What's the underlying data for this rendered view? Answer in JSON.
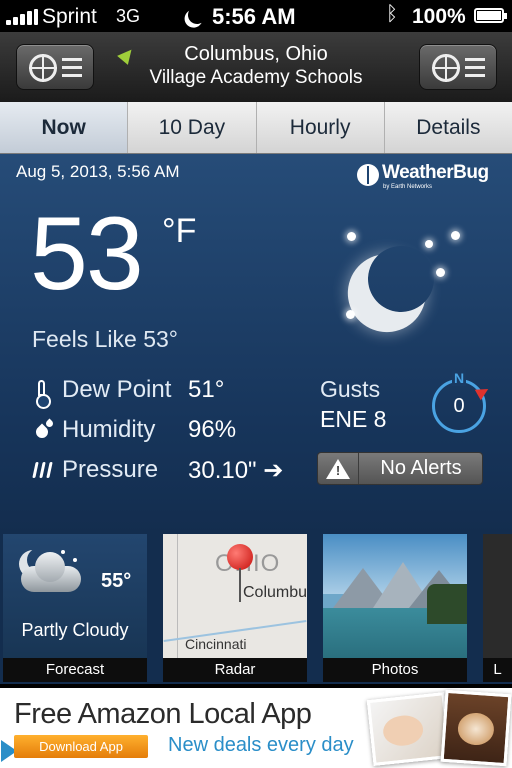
{
  "status_bar": {
    "carrier": "Sprint",
    "network": "3G",
    "time": "5:56 AM",
    "battery": "100%"
  },
  "header": {
    "city": "Columbus, Ohio",
    "station": "Village Academy Schools"
  },
  "tabs": [
    {
      "label": "Now",
      "active": true
    },
    {
      "label": "10 Day",
      "active": false
    },
    {
      "label": "Hourly",
      "active": false
    },
    {
      "label": "Details",
      "active": false
    }
  ],
  "now": {
    "timestamp": "Aug 5, 2013, 5:56 AM",
    "brand": "WeatherBug",
    "brand_sub": "by Earth Networks",
    "temperature": "53",
    "unit": "°F",
    "feels_like": "Feels Like 53°",
    "dew_point_label": "Dew Point",
    "dew_point_value": "51°",
    "humidity_label": "Humidity",
    "humidity_value": "96%",
    "pressure_label": "Pressure",
    "pressure_value": "30.10\" ➔",
    "gusts_label": "Gusts",
    "gusts_value": "ENE 8",
    "compass_north": "N",
    "compass_value": "0",
    "alerts_label": "No Alerts",
    "alerts_icon_glyph": "!"
  },
  "thumbnails": {
    "forecast": {
      "caption": "Forecast",
      "temp": "55°",
      "condition": "Partly Cloudy"
    },
    "radar": {
      "caption": "Radar",
      "state_label": "OHIO",
      "city1": "Columbu",
      "city2": "Cincinnati"
    },
    "photos": {
      "caption": "Photos"
    },
    "more": {
      "caption": "L"
    }
  },
  "ad": {
    "title": "Free Amazon Local App",
    "button": "Download App",
    "tagline": "New deals every day"
  },
  "colors": {
    "panel_top": "#264c78",
    "panel_bottom": "#132d4e",
    "accent_blue": "#4aa3e3",
    "compass_needle": "#e0322d",
    "location_arrow": "#9fce3a",
    "ad_button": "#f29a1d",
    "ad_tagline": "#2a8ec8"
  },
  "icons": {
    "signal": "signal-bars-icon",
    "moon": "moon-icon",
    "bluetooth": "bluetooth-icon",
    "battery": "battery-icon",
    "location": "location-arrow-icon",
    "menu": "bug-menu-icon",
    "settings": "target-menu-icon",
    "dew": "thermometer-icon",
    "humidity": "droplets-icon",
    "pressure": "pressure-waves-icon",
    "alert": "warning-icon"
  }
}
